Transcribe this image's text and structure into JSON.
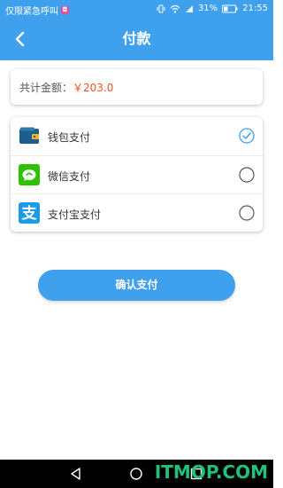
{
  "status_bar": {
    "carrier": "仅限紧急呼叫",
    "battery_percent": "31%",
    "time": "21:55"
  },
  "header": {
    "title": "付款"
  },
  "summary": {
    "label": "共计金额：",
    "amount": "￥203.0"
  },
  "payment_methods": [
    {
      "label": "钱包支付",
      "icon": "wallet-icon",
      "selected": true
    },
    {
      "label": "微信支付",
      "icon": "wechat-icon",
      "selected": false
    },
    {
      "label": "支付宝支付",
      "icon": "alipay-icon",
      "selected": false
    }
  ],
  "confirm_button": {
    "label": "确认支付"
  },
  "watermark": "ITMOP.COM",
  "colors": {
    "primary": "#3fa0ee",
    "amount": "#f0541e",
    "wechat": "#2dc100",
    "alipay": "#1e9be8"
  }
}
